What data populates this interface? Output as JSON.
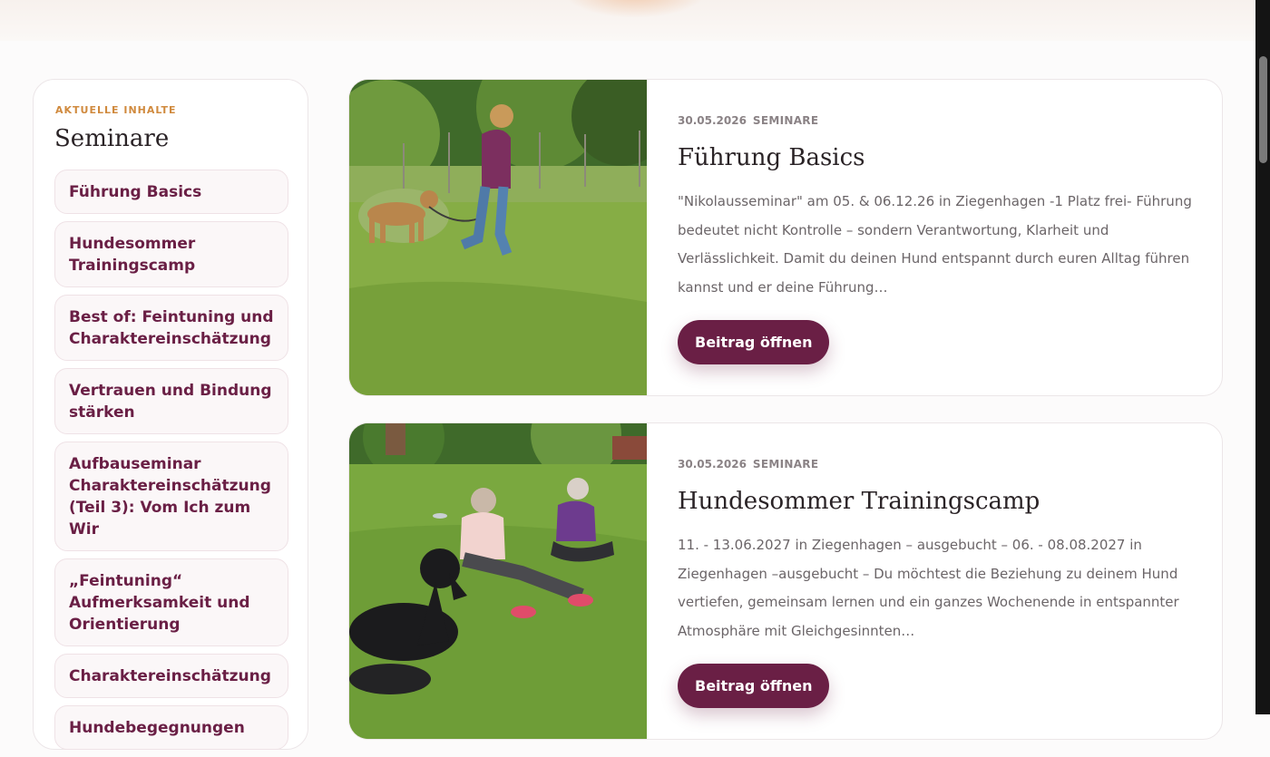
{
  "sidebar": {
    "eyebrow": "AKTUELLE INHALTE",
    "title": "Seminare",
    "items": [
      {
        "label": "Führung Basics"
      },
      {
        "label": "Hundesommer Trainingscamp"
      },
      {
        "label": "Best of: Feintuning und Charaktereinschätzung"
      },
      {
        "label": "Vertrauen und Bindung stärken"
      },
      {
        "label": "Aufbauseminar Charaktereinschätzung (Teil 3): Vom Ich zum Wir"
      },
      {
        "label": "„Feintuning“ Aufmerksamkeit und Orientierung"
      },
      {
        "label": "Charaktereinschätzung"
      },
      {
        "label": "Hundebegegnungen"
      }
    ]
  },
  "posts": [
    {
      "date": "30.05.2026",
      "category": "SEMINARE",
      "title": "Führung Basics",
      "excerpt": "\"Nikolausseminar\" am 05. & 06.12.26 in Ziegenhagen -1 Platz frei- Führung bedeutet nicht Kontrolle – sondern Verantwortung, Klarheit und Verlässlichkeit. Damit du deinen Hund entspannt durch euren Alltag führen kannst und er deine Führung…",
      "button": "Beitrag öffnen",
      "image": "woman-walking-dog-on-meadow"
    },
    {
      "date": "30.05.2026",
      "category": "SEMINARE",
      "title": "Hundesommer Trainingscamp",
      "excerpt": "11. - 13.06.2027 in Ziegenhagen – ausgebucht – 06. - 08.08.2027 in Ziegenhagen –ausgebucht – Du möchtest die Beziehung zu deinem Hund vertiefen, gemeinsam lernen und ein ganzes Wochenende in entspannter Atmosphäre mit Gleichgesinnten…",
      "button": "Beitrag öffnen",
      "image": "two-women-sitting-with-black-dog-on-lawn"
    }
  ],
  "colors": {
    "accent": "#6a1f45",
    "eyebrow": "#d08a3e",
    "text": "#2a2326",
    "muted": "#6b6568"
  }
}
